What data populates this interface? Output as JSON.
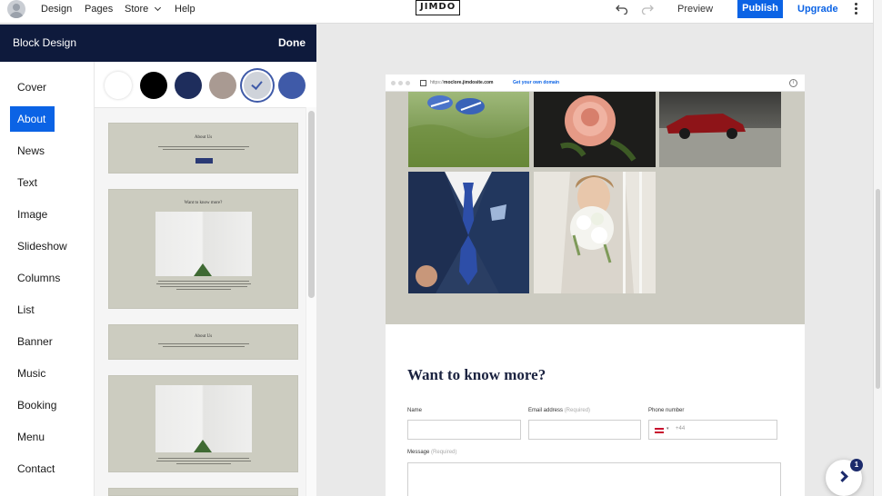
{
  "topbar": {
    "nav": [
      "Design",
      "Pages",
      "Store",
      "Help"
    ],
    "logo": "JIMDO",
    "preview": "Preview",
    "publish": "Publish",
    "upgrade": "Upgrade"
  },
  "panel": {
    "title": "Block Design",
    "done": "Done",
    "categories": [
      "Cover",
      "About",
      "News",
      "Text",
      "Image",
      "Slideshow",
      "Columns",
      "List",
      "Banner",
      "Music",
      "Booking",
      "Menu",
      "Contact"
    ],
    "active_category": "About",
    "swatches": [
      "#ffffff",
      "#000000",
      "#1e2d5c",
      "#a99a92",
      "#cfd3da",
      "#3f5aa8"
    ],
    "selected_swatch": 4,
    "thumbs": {
      "about_title": "About Us",
      "contact_title": "Want to know more?",
      "about_title_small": "About Us"
    }
  },
  "site": {
    "url_prefix": "https://",
    "url_domain": "moclore.jimdosite.com",
    "domain_link": "Get your own domain",
    "heading": "Want to know more?",
    "form": {
      "name_label": "Name",
      "email_label": "Email address",
      "email_req": "(Required)",
      "phone_label": "Phone number",
      "phone_code": "+44",
      "message_label": "Message",
      "message_req": "(Required)"
    }
  },
  "chat": {
    "badge": "1"
  },
  "colors": {
    "accent": "#0b63e5",
    "panel_header": "#0e1a3c",
    "gallery_bg": "#cccbc1"
  }
}
